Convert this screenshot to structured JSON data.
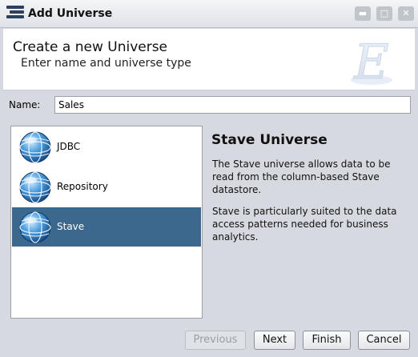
{
  "window": {
    "title": "Add Universe",
    "controls": [
      "minimize",
      "maximize",
      "close"
    ]
  },
  "header": {
    "title": "Create a new Universe",
    "subtitle": "Enter name and universe type",
    "emblem_letter": "E"
  },
  "name_field": {
    "label": "Name:",
    "value": "Sales"
  },
  "universe_types": [
    {
      "label": "JDBC",
      "icon": "globe-icon",
      "selected": false
    },
    {
      "label": "Repository",
      "icon": "globe-icon",
      "selected": false
    },
    {
      "label": "Stave",
      "icon": "globe-icon",
      "selected": true
    }
  ],
  "description": {
    "title": "Stave Universe",
    "paragraph1": "The Stave universe allows data to be read from the column-based Stave datastore.",
    "paragraph2": "Stave is particularly suited to the data access patterns needed for business analytics."
  },
  "buttons": {
    "previous": "Previous",
    "next": "Next",
    "finish": "Finish",
    "cancel": "Cancel"
  },
  "colors": {
    "selection": "#3c688e",
    "background": "#d6d9df"
  }
}
